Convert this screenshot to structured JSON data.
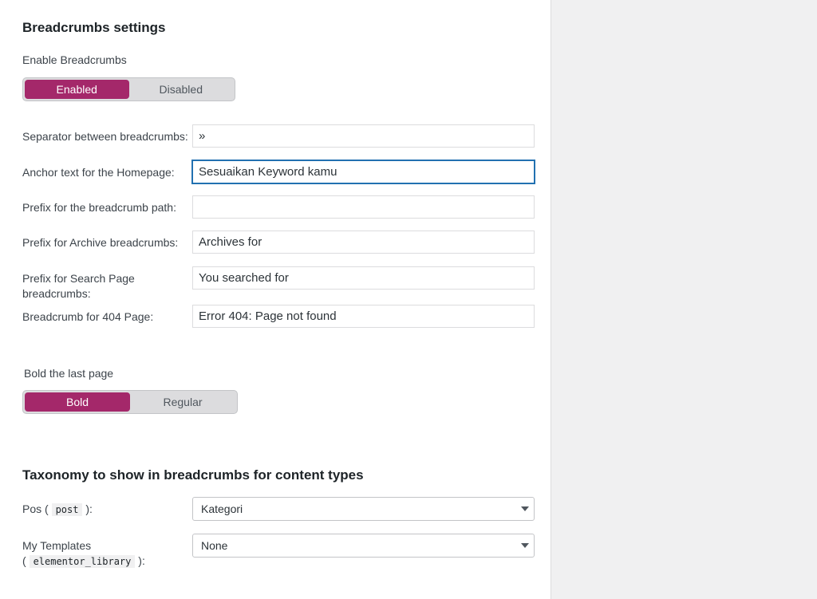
{
  "breadcrumbs": {
    "title": "Breadcrumbs settings",
    "enable_label": "Enable Breadcrumbs",
    "enable_toggle": {
      "on": "Enabled",
      "off": "Disabled",
      "selected": "Enabled"
    },
    "fields": {
      "separator": {
        "label": "Separator between breadcrumbs:",
        "value": "»"
      },
      "home_anchor": {
        "label": "Anchor text for the Homepage:",
        "value": "Sesuaikan Keyword kamu"
      },
      "prefix_path": {
        "label": "Prefix for the breadcrumb path:",
        "value": ""
      },
      "prefix_archive": {
        "label": "Prefix for Archive breadcrumbs:",
        "value": "Archives for"
      },
      "prefix_search": {
        "label_line1": "Prefix for Search Page",
        "label_line2": "breadcrumbs:",
        "value": "You searched for"
      },
      "crumb_404": {
        "label": "Breadcrumb for 404 Page:",
        "value": "Error 404: Page not found"
      }
    },
    "bold_label": "Bold the last page",
    "bold_toggle": {
      "on": "Bold",
      "off": "Regular",
      "selected": "Bold"
    }
  },
  "taxonomy": {
    "title": "Taxonomy to show in breadcrumbs for content types",
    "rows": [
      {
        "label_prefix": "Pos (",
        "code": "post",
        "label_suffix": "):",
        "selected": "Kategori"
      },
      {
        "label_line1": "My Templates",
        "label_prefix": "(",
        "code": "elementor_library",
        "label_suffix": "):",
        "selected": "None"
      }
    ]
  },
  "colors": {
    "accent": "#a4286a",
    "focus": "#2271b1"
  }
}
